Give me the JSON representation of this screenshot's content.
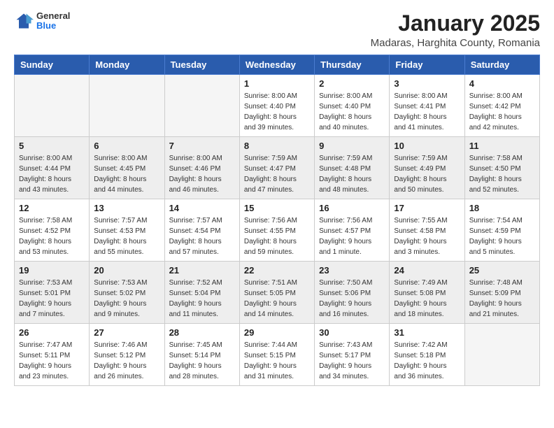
{
  "header": {
    "logo_general": "General",
    "logo_blue": "Blue",
    "month_title": "January 2025",
    "subtitle": "Madaras, Harghita County, Romania"
  },
  "weekdays": [
    "Sunday",
    "Monday",
    "Tuesday",
    "Wednesday",
    "Thursday",
    "Friday",
    "Saturday"
  ],
  "weeks": [
    {
      "shaded": false,
      "days": [
        {
          "num": "",
          "info": ""
        },
        {
          "num": "",
          "info": ""
        },
        {
          "num": "",
          "info": ""
        },
        {
          "num": "1",
          "info": "Sunrise: 8:00 AM\nSunset: 4:40 PM\nDaylight: 8 hours\nand 39 minutes."
        },
        {
          "num": "2",
          "info": "Sunrise: 8:00 AM\nSunset: 4:40 PM\nDaylight: 8 hours\nand 40 minutes."
        },
        {
          "num": "3",
          "info": "Sunrise: 8:00 AM\nSunset: 4:41 PM\nDaylight: 8 hours\nand 41 minutes."
        },
        {
          "num": "4",
          "info": "Sunrise: 8:00 AM\nSunset: 4:42 PM\nDaylight: 8 hours\nand 42 minutes."
        }
      ]
    },
    {
      "shaded": true,
      "days": [
        {
          "num": "5",
          "info": "Sunrise: 8:00 AM\nSunset: 4:44 PM\nDaylight: 8 hours\nand 43 minutes."
        },
        {
          "num": "6",
          "info": "Sunrise: 8:00 AM\nSunset: 4:45 PM\nDaylight: 8 hours\nand 44 minutes."
        },
        {
          "num": "7",
          "info": "Sunrise: 8:00 AM\nSunset: 4:46 PM\nDaylight: 8 hours\nand 46 minutes."
        },
        {
          "num": "8",
          "info": "Sunrise: 7:59 AM\nSunset: 4:47 PM\nDaylight: 8 hours\nand 47 minutes."
        },
        {
          "num": "9",
          "info": "Sunrise: 7:59 AM\nSunset: 4:48 PM\nDaylight: 8 hours\nand 48 minutes."
        },
        {
          "num": "10",
          "info": "Sunrise: 7:59 AM\nSunset: 4:49 PM\nDaylight: 8 hours\nand 50 minutes."
        },
        {
          "num": "11",
          "info": "Sunrise: 7:58 AM\nSunset: 4:50 PM\nDaylight: 8 hours\nand 52 minutes."
        }
      ]
    },
    {
      "shaded": false,
      "days": [
        {
          "num": "12",
          "info": "Sunrise: 7:58 AM\nSunset: 4:52 PM\nDaylight: 8 hours\nand 53 minutes."
        },
        {
          "num": "13",
          "info": "Sunrise: 7:57 AM\nSunset: 4:53 PM\nDaylight: 8 hours\nand 55 minutes."
        },
        {
          "num": "14",
          "info": "Sunrise: 7:57 AM\nSunset: 4:54 PM\nDaylight: 8 hours\nand 57 minutes."
        },
        {
          "num": "15",
          "info": "Sunrise: 7:56 AM\nSunset: 4:55 PM\nDaylight: 8 hours\nand 59 minutes."
        },
        {
          "num": "16",
          "info": "Sunrise: 7:56 AM\nSunset: 4:57 PM\nDaylight: 9 hours\nand 1 minute."
        },
        {
          "num": "17",
          "info": "Sunrise: 7:55 AM\nSunset: 4:58 PM\nDaylight: 9 hours\nand 3 minutes."
        },
        {
          "num": "18",
          "info": "Sunrise: 7:54 AM\nSunset: 4:59 PM\nDaylight: 9 hours\nand 5 minutes."
        }
      ]
    },
    {
      "shaded": true,
      "days": [
        {
          "num": "19",
          "info": "Sunrise: 7:53 AM\nSunset: 5:01 PM\nDaylight: 9 hours\nand 7 minutes."
        },
        {
          "num": "20",
          "info": "Sunrise: 7:53 AM\nSunset: 5:02 PM\nDaylight: 9 hours\nand 9 minutes."
        },
        {
          "num": "21",
          "info": "Sunrise: 7:52 AM\nSunset: 5:04 PM\nDaylight: 9 hours\nand 11 minutes."
        },
        {
          "num": "22",
          "info": "Sunrise: 7:51 AM\nSunset: 5:05 PM\nDaylight: 9 hours\nand 14 minutes."
        },
        {
          "num": "23",
          "info": "Sunrise: 7:50 AM\nSunset: 5:06 PM\nDaylight: 9 hours\nand 16 minutes."
        },
        {
          "num": "24",
          "info": "Sunrise: 7:49 AM\nSunset: 5:08 PM\nDaylight: 9 hours\nand 18 minutes."
        },
        {
          "num": "25",
          "info": "Sunrise: 7:48 AM\nSunset: 5:09 PM\nDaylight: 9 hours\nand 21 minutes."
        }
      ]
    },
    {
      "shaded": false,
      "days": [
        {
          "num": "26",
          "info": "Sunrise: 7:47 AM\nSunset: 5:11 PM\nDaylight: 9 hours\nand 23 minutes."
        },
        {
          "num": "27",
          "info": "Sunrise: 7:46 AM\nSunset: 5:12 PM\nDaylight: 9 hours\nand 26 minutes."
        },
        {
          "num": "28",
          "info": "Sunrise: 7:45 AM\nSunset: 5:14 PM\nDaylight: 9 hours\nand 28 minutes."
        },
        {
          "num": "29",
          "info": "Sunrise: 7:44 AM\nSunset: 5:15 PM\nDaylight: 9 hours\nand 31 minutes."
        },
        {
          "num": "30",
          "info": "Sunrise: 7:43 AM\nSunset: 5:17 PM\nDaylight: 9 hours\nand 34 minutes."
        },
        {
          "num": "31",
          "info": "Sunrise: 7:42 AM\nSunset: 5:18 PM\nDaylight: 9 hours\nand 36 minutes."
        },
        {
          "num": "",
          "info": ""
        }
      ]
    }
  ]
}
